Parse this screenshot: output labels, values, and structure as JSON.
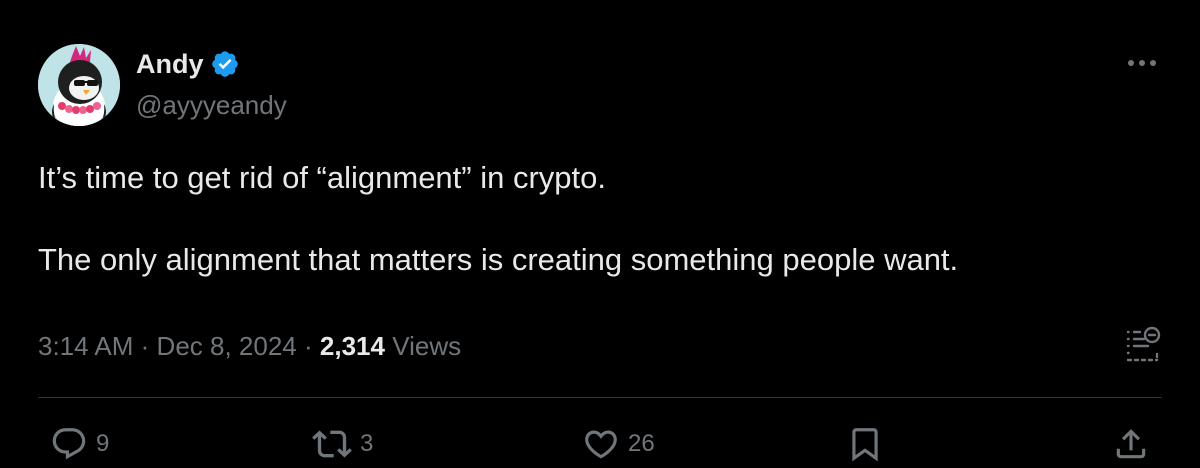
{
  "author": {
    "display_name": "Andy",
    "handle": "@ayyyeandy",
    "verified": true
  },
  "tweet": {
    "paragraphs": [
      "It’s time to get rid of “alignment” in crypto.",
      "The only alignment that matters is creating something people want."
    ]
  },
  "meta": {
    "time": "3:14 AM",
    "separator": "·",
    "date": "Dec 8, 2024",
    "views_count": "2,314",
    "views_label": "Views"
  },
  "actions": {
    "replies": "9",
    "reposts": "3",
    "likes": "26"
  },
  "icons": {
    "more": "more-dots-icon",
    "verified": "verified-badge-icon",
    "summary": "grok-summary-icon",
    "reply": "reply-icon",
    "repost": "repost-icon",
    "like": "heart-icon",
    "bookmark": "bookmark-icon",
    "share": "share-icon"
  },
  "colors": {
    "background": "#000000",
    "text": "#e7e9ea",
    "secondary": "#71767b",
    "verified": "#1d9bf0",
    "divider": "#2f3336"
  }
}
